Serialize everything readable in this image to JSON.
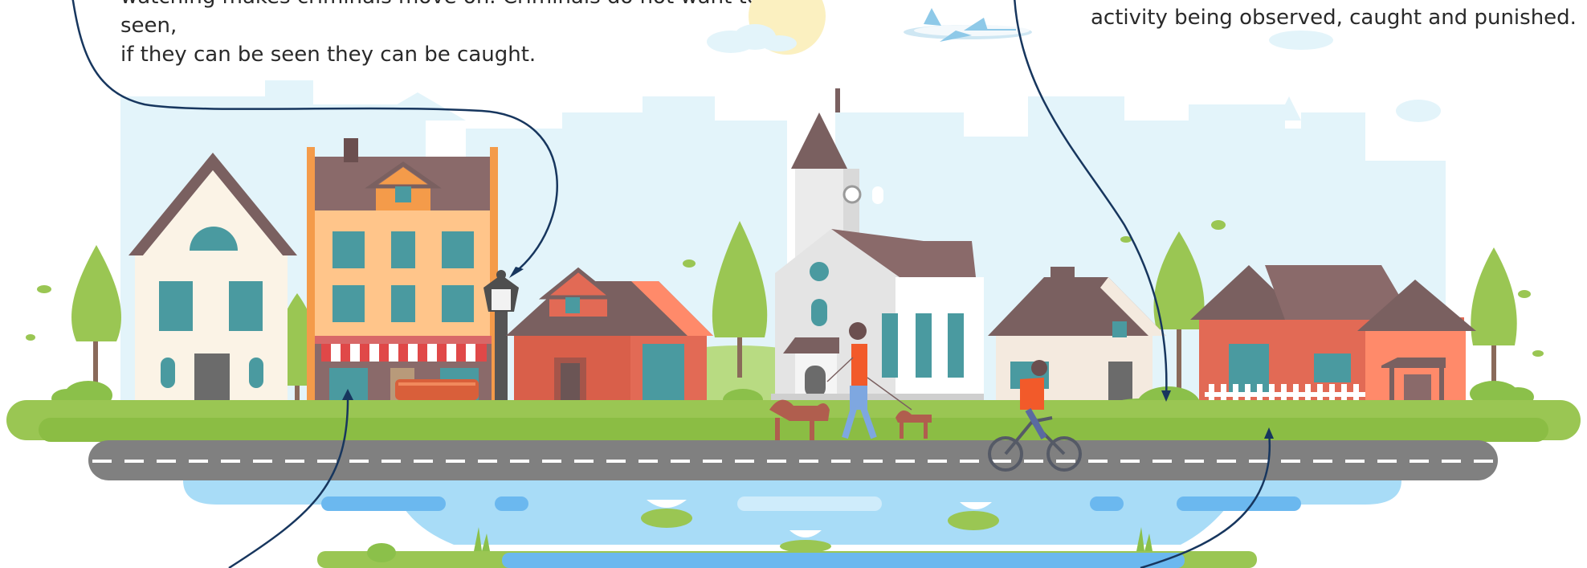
{
  "captions": {
    "left_line1": "watching makes criminals move on. Criminals do not want to be seen,",
    "left_line2": "if they can be seen they can be caught.",
    "right_line1": "activity being observed, caught and punished."
  },
  "colors": {
    "sky_buildings": "#e3f4fa",
    "grass": "#9ac653",
    "road": "#808080",
    "water": "#a8dcf7",
    "arrow": "#17365e",
    "roof": "#7a6060",
    "window": "#4a9aa0"
  }
}
